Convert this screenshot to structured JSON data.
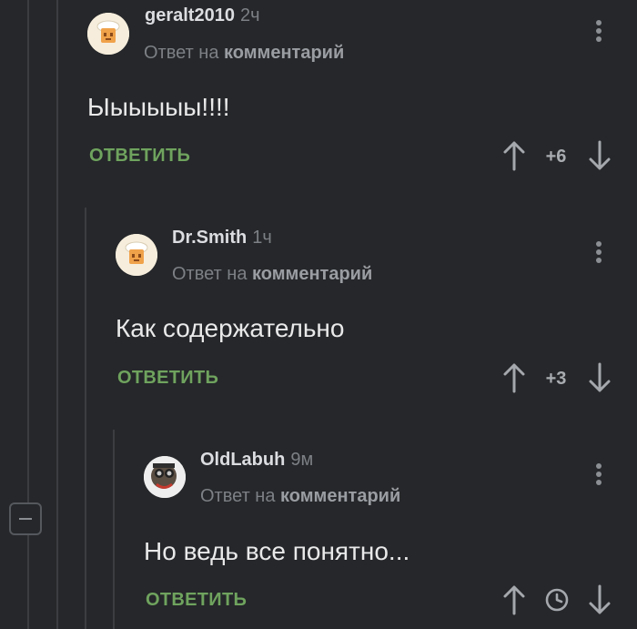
{
  "comments": [
    {
      "author": "geralt2010",
      "time": "2ч",
      "reply_prefix": "Ответ на",
      "reply_target": "комментарий",
      "text": "Ыыыыыы!!!!",
      "reply_label": "ОТВЕТИТЬ",
      "rating": "+6"
    },
    {
      "author": "Dr.Smith",
      "time": "1ч",
      "reply_prefix": "Ответ на",
      "reply_target": "комментарий",
      "text": "Как содержательно",
      "reply_label": "ОТВЕТИТЬ",
      "rating": "+3"
    },
    {
      "author": "OldLabuh",
      "time": "9м",
      "reply_prefix": "Ответ на",
      "reply_target": "комментарий",
      "text": "Но ведь все понятно...",
      "reply_label": "ОТВЕТИТЬ",
      "rating_icon": "clock-icon"
    }
  ],
  "colors": {
    "background": "#25272a",
    "reply_accent": "#6fa35e",
    "muted_text": "#7d8085",
    "thread_line": "#3b3d41"
  },
  "icons": [
    "chef-avatar",
    "chef-avatar",
    "photo-avatar",
    "kebab-menu-icon",
    "arrow-up-icon",
    "arrow-down-icon",
    "clock-icon",
    "collapse-minus-icon"
  ]
}
